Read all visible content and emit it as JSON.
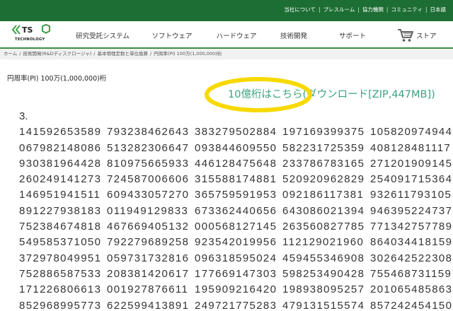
{
  "topbar": {
    "links": [
      "当社について",
      "プレスルーム",
      "協力機関",
      "コミュニティ",
      "日本語"
    ],
    "separator": "|"
  },
  "logo": {
    "name": "TS",
    "sub": "TECHNOLOGY"
  },
  "nav": {
    "items": [
      "研究受託システム",
      "ソフトウェア",
      "ハードウェア",
      "技術開発",
      "サポート"
    ],
    "store": "ストア"
  },
  "breadcrumb": {
    "items": [
      "ホーム",
      "技術開発(R&Dディスクロージャ)",
      "基本物理定数と単位換算",
      "円周率(PI) 100万(1,000,000)桁"
    ],
    "separator": "/"
  },
  "page_title": "円周率(PI) 100万(1,000,000)桁",
  "download_link": "10億桁はこちら(ダウンロード[ZIP,447MB])",
  "pi": {
    "lead": "3.",
    "rows": [
      [
        "141592653589",
        "793238462643",
        "383279502884",
        "197169399375",
        "105820974944"
      ],
      [
        "067982148086",
        "513282306647",
        "093844609550",
        "582231725359",
        "408128481117"
      ],
      [
        "930381964428",
        "810975665933",
        "446128475648",
        "233786783165",
        "271201909145"
      ],
      [
        "260249141273",
        "724587006606",
        "315588174881",
        "520920962829",
        "254091715364"
      ],
      [
        "146951941511",
        "609433057270",
        "365759591953",
        "092186117381",
        "932611793105"
      ],
      [
        "891227938183",
        "011949129833",
        "673362440656",
        "643086021394",
        "946395224737"
      ],
      [
        "752384674818",
        "467669405132",
        "000568127145",
        "263560827785",
        "771342757789"
      ],
      [
        "549585371050",
        "792279689258",
        "923542019956",
        "112129021960",
        "864034418159"
      ],
      [
        "372978049951",
        "059731732816",
        "096318595024",
        "459455346908",
        "302642522308"
      ],
      [
        "752886587533",
        "208381420617",
        "177669147303",
        "598253490428",
        "755468731159"
      ],
      [
        "171226806613",
        "001927876611",
        "195909216420",
        "198938095257",
        "201065485863"
      ],
      [
        "852968995773",
        "622599413891",
        "249721775283",
        "479131515574",
        "857242454150"
      ]
    ]
  },
  "colors": {
    "topbar": "#1d6e34",
    "header_rule": "#3a8f47",
    "link": "#3ba37d",
    "highlight": "#f7d900",
    "text": "#333333"
  },
  "icons": {
    "logo": "ts-logo-icon",
    "cart": "shopping-cart-icon",
    "annotation": "highlight-ellipse"
  }
}
